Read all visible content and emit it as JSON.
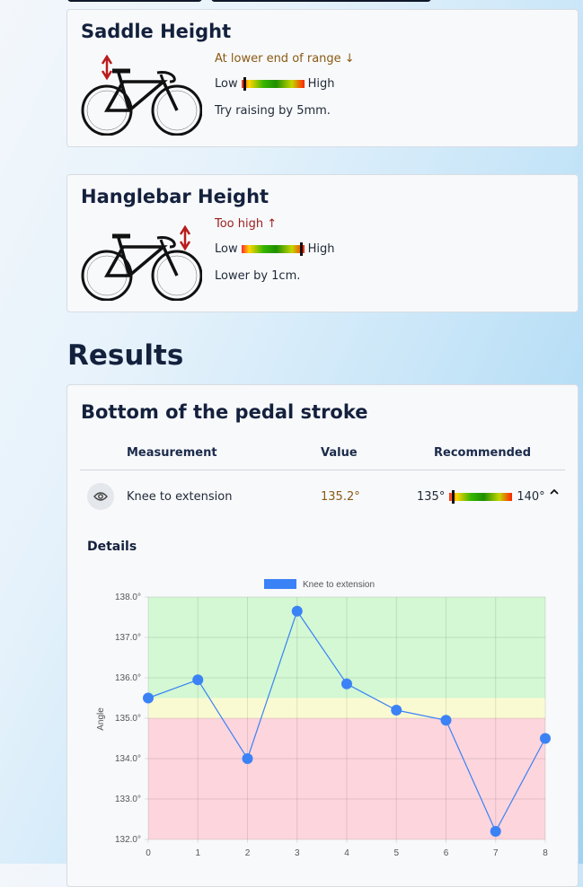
{
  "saddle": {
    "title": "Saddle Height",
    "status": "At lower end of range ↓",
    "low": "Low",
    "high": "High",
    "tip": "Try raising by 5mm.",
    "level": 0.04
  },
  "handlebar": {
    "title": "Hanglebar Height",
    "status": "Too high ↑",
    "low": "Low",
    "high": "High",
    "tip": "Lower by 1cm.",
    "level": 0.97
  },
  "results": {
    "heading": "Results",
    "section_title": "Bottom of the pedal stroke",
    "columns": [
      "Measurement",
      "Value",
      "Recommended"
    ],
    "row": {
      "measurement": "Knee to extension",
      "value": "135.2°",
      "rec_low": "135°",
      "rec_high": "140°",
      "level": 0.04
    },
    "details_label": "Details"
  },
  "colors": {
    "good_zone": "#d3f8d3",
    "warn_zone": "#fafad2",
    "bad_zone": "#fdd5dc",
    "series": "#3b82f6"
  },
  "chart_data": {
    "type": "line",
    "legend": [
      "Knee to extension"
    ],
    "ylabel": "Angle",
    "ylim": [
      132,
      138
    ],
    "yticks": [
      "132.0°",
      "133.0°",
      "134.0°",
      "135.0°",
      "136.0°",
      "137.0°",
      "138.0°"
    ],
    "x": [
      0,
      1,
      2,
      3,
      4,
      5,
      6,
      7,
      8
    ],
    "series": [
      {
        "name": "Knee to extension",
        "values": [
          135.5,
          135.95,
          134.0,
          137.65,
          135.85,
          135.2,
          134.95,
          132.2,
          134.5
        ]
      }
    ],
    "zones": [
      {
        "from": 132,
        "to": 135,
        "color": "bad"
      },
      {
        "from": 135,
        "to": 135.5,
        "color": "warn"
      },
      {
        "from": 135.5,
        "to": 138,
        "color": "good"
      }
    ]
  }
}
